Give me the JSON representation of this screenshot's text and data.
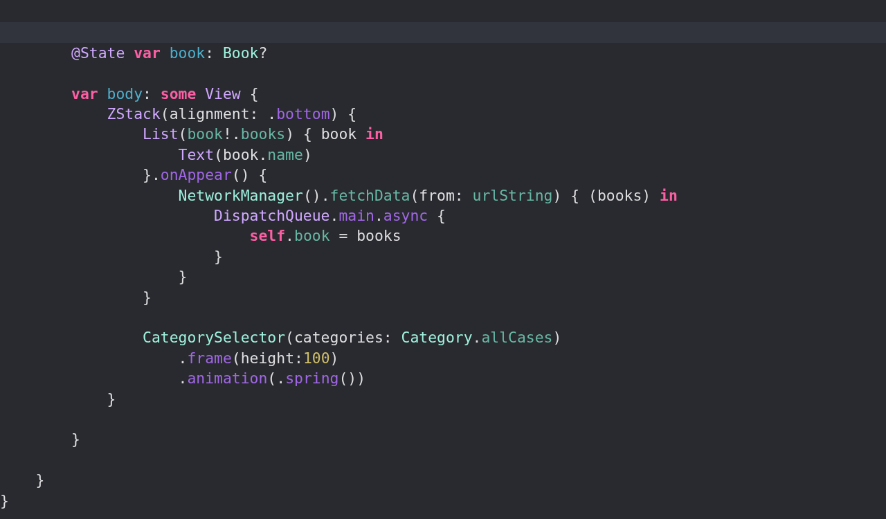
{
  "editor": {
    "lines": [
      {
        "kind": "blank"
      },
      {
        "kind": "blank",
        "current": true
      },
      {
        "tokens": [
          {
            "text": "        @State",
            "kind": "systype"
          },
          {
            "text": " var",
            "kind": "keyword"
          },
          {
            "text": " book",
            "kind": "declaration"
          },
          {
            "text": ": ",
            "kind": "plain"
          },
          {
            "text": "Book",
            "kind": "type"
          },
          {
            "text": "?",
            "kind": "plain"
          }
        ]
      },
      {
        "kind": "blank"
      },
      {
        "tokens": [
          {
            "text": "        var",
            "kind": "keyword"
          },
          {
            "text": " body",
            "kind": "declaration"
          },
          {
            "text": ": ",
            "kind": "plain"
          },
          {
            "text": "some",
            "kind": "keyword"
          },
          {
            "text": " View",
            "kind": "systype"
          },
          {
            "text": " {",
            "kind": "plain"
          }
        ]
      },
      {
        "tokens": [
          {
            "text": "            ZStack",
            "kind": "systype"
          },
          {
            "text": "(alignment: .",
            "kind": "plain"
          },
          {
            "text": "bottom",
            "kind": "sysmember"
          },
          {
            "text": ") {",
            "kind": "plain"
          }
        ]
      },
      {
        "tokens": [
          {
            "text": "                List",
            "kind": "systype"
          },
          {
            "text": "(",
            "kind": "plain"
          },
          {
            "text": "book",
            "kind": "member"
          },
          {
            "text": "!.",
            "kind": "plain"
          },
          {
            "text": "books",
            "kind": "member"
          },
          {
            "text": ") { book ",
            "kind": "plain"
          },
          {
            "text": "in",
            "kind": "keyword"
          }
        ]
      },
      {
        "tokens": [
          {
            "text": "                    Text",
            "kind": "systype"
          },
          {
            "text": "(book.",
            "kind": "plain"
          },
          {
            "text": "name",
            "kind": "member"
          },
          {
            "text": ")",
            "kind": "plain"
          }
        ]
      },
      {
        "tokens": [
          {
            "text": "                }.",
            "kind": "plain"
          },
          {
            "text": "onAppear",
            "kind": "sysmember"
          },
          {
            "text": "() {",
            "kind": "plain"
          }
        ]
      },
      {
        "tokens": [
          {
            "text": "                    NetworkManager",
            "kind": "type"
          },
          {
            "text": "().",
            "kind": "plain"
          },
          {
            "text": "fetchData",
            "kind": "member"
          },
          {
            "text": "(from: ",
            "kind": "plain"
          },
          {
            "text": "urlString",
            "kind": "member"
          },
          {
            "text": ") { (books) ",
            "kind": "plain"
          },
          {
            "text": "in",
            "kind": "keyword"
          }
        ]
      },
      {
        "tokens": [
          {
            "text": "                        DispatchQueue",
            "kind": "systype"
          },
          {
            "text": ".",
            "kind": "plain"
          },
          {
            "text": "main",
            "kind": "sysmember"
          },
          {
            "text": ".",
            "kind": "plain"
          },
          {
            "text": "async",
            "kind": "sysmember"
          },
          {
            "text": " {",
            "kind": "plain"
          }
        ]
      },
      {
        "tokens": [
          {
            "text": "                            self",
            "kind": "keyword"
          },
          {
            "text": ".",
            "kind": "plain"
          },
          {
            "text": "book",
            "kind": "member"
          },
          {
            "text": " = books",
            "kind": "plain"
          }
        ]
      },
      {
        "tokens": [
          {
            "text": "                        }",
            "kind": "plain"
          }
        ]
      },
      {
        "tokens": [
          {
            "text": "                    }",
            "kind": "plain"
          }
        ]
      },
      {
        "tokens": [
          {
            "text": "                }",
            "kind": "plain"
          }
        ]
      },
      {
        "kind": "blank"
      },
      {
        "tokens": [
          {
            "text": "                CategorySelector",
            "kind": "type"
          },
          {
            "text": "(categories: ",
            "kind": "plain"
          },
          {
            "text": "Category",
            "kind": "type"
          },
          {
            "text": ".",
            "kind": "plain"
          },
          {
            "text": "allCases",
            "kind": "member"
          },
          {
            "text": ")",
            "kind": "plain"
          }
        ]
      },
      {
        "tokens": [
          {
            "text": "                    .",
            "kind": "plain"
          },
          {
            "text": "frame",
            "kind": "sysmember"
          },
          {
            "text": "(height:",
            "kind": "plain"
          },
          {
            "text": "100",
            "kind": "number"
          },
          {
            "text": ")",
            "kind": "plain"
          }
        ]
      },
      {
        "tokens": [
          {
            "text": "                    .",
            "kind": "plain"
          },
          {
            "text": "animation",
            "kind": "sysmember"
          },
          {
            "text": "(.",
            "kind": "plain"
          },
          {
            "text": "spring",
            "kind": "sysmember"
          },
          {
            "text": "())",
            "kind": "plain"
          }
        ]
      },
      {
        "tokens": [
          {
            "text": "            }",
            "kind": "plain"
          }
        ]
      },
      {
        "kind": "blank"
      },
      {
        "tokens": [
          {
            "text": "        }",
            "kind": "plain"
          }
        ]
      },
      {
        "kind": "blank"
      },
      {
        "tokens": [
          {
            "text": "    }",
            "kind": "plain"
          }
        ]
      },
      {
        "tokens": [
          {
            "text": "}",
            "kind": "plain"
          }
        ]
      }
    ]
  }
}
